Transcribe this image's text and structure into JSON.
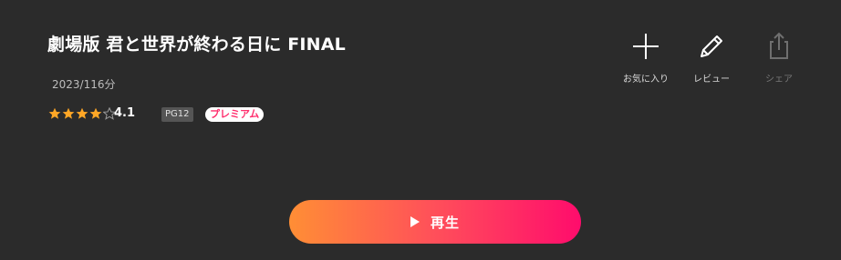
{
  "title": "劇場版 君と世界が終わる日に FINAL",
  "meta": "2023/116分",
  "rating": {
    "value": "4.1",
    "stars_filled": 4,
    "stars_total": 5,
    "star_color": "#ffa726",
    "empty_star_color": "#9a9a9a"
  },
  "badges": {
    "pg": "PG12",
    "premium": "プレミアム"
  },
  "actions": {
    "favorite": {
      "label": "お気に入り",
      "icon": "plus-icon"
    },
    "review": {
      "label": "レビュー",
      "icon": "pencil-icon"
    },
    "share": {
      "label": "シェア",
      "icon": "share-icon",
      "disabled": true
    }
  },
  "play": {
    "label": "再生",
    "icon": "play-icon",
    "gradient_start": "#ff8e35",
    "gradient_end": "#ff0c6c"
  },
  "colors": {
    "background": "#2b2b2b",
    "text": "#ffffff"
  }
}
